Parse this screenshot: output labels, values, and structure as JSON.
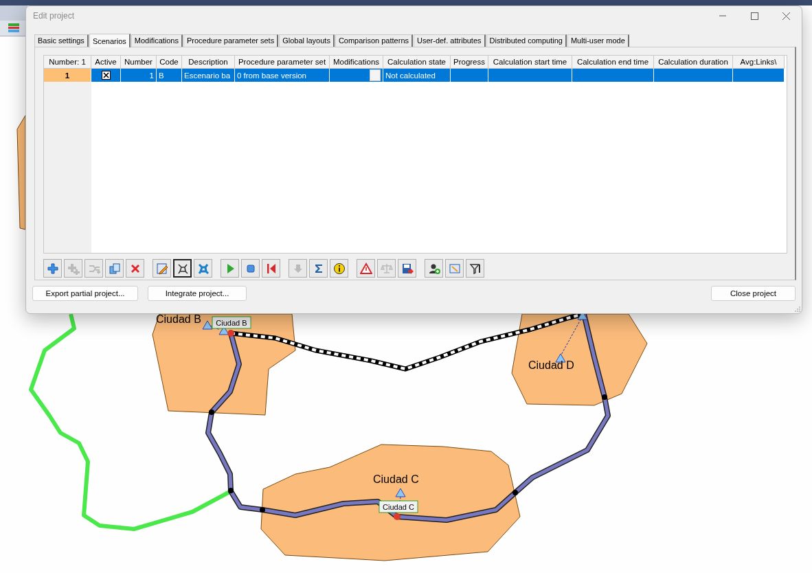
{
  "map": {
    "cities": [
      {
        "name": "Ciudad B",
        "tag": "Ciudad B"
      },
      {
        "name": "Ciudad D"
      },
      {
        "name": "Ciudad C",
        "tag": "Ciudad C"
      }
    ]
  },
  "window": {
    "title": "Edit project"
  },
  "tabs": [
    {
      "label": "Basic settings",
      "selected": false
    },
    {
      "label": "Scenarios",
      "selected": true
    },
    {
      "label": "Modifications",
      "selected": false
    },
    {
      "label": "Procedure parameter sets",
      "selected": false
    },
    {
      "label": "Global layouts",
      "selected": false
    },
    {
      "label": "Comparison patterns",
      "selected": false
    },
    {
      "label": "User-def. attributes",
      "selected": false
    },
    {
      "label": "Distributed computing",
      "selected": false
    },
    {
      "label": "Multi-user mode",
      "selected": false
    }
  ],
  "table": {
    "columns": [
      "Number: 1",
      "Active",
      "Number",
      "Code",
      "Description",
      "Procedure parameter set",
      "Modifications",
      "Calculation state",
      "Progress",
      "Calculation start time",
      "Calculation end time",
      "Calculation duration",
      "Avg:Links\\"
    ],
    "rows": [
      {
        "selected": true,
        "key": "1",
        "active": true,
        "number": "1",
        "code": "B",
        "description": "Escenario ba",
        "procedure_parameter_set": "0 from base version",
        "calculation_state": "Not calculated"
      }
    ]
  },
  "toolbar": [
    {
      "kind": "add",
      "disabled": false,
      "pressed": false
    },
    {
      "kind": "add-more",
      "disabled": true,
      "pressed": false
    },
    {
      "kind": "merge",
      "disabled": true,
      "pressed": false
    },
    {
      "kind": "copy",
      "disabled": false,
      "pressed": false
    },
    {
      "kind": "delete",
      "disabled": false,
      "pressed": false
    },
    {
      "kind": "edit",
      "disabled": false,
      "pressed": false
    },
    {
      "kind": "network",
      "disabled": false,
      "pressed": true
    },
    {
      "kind": "network-bold",
      "disabled": false,
      "pressed": false
    },
    {
      "kind": "play",
      "disabled": false,
      "pressed": false
    },
    {
      "kind": "stop",
      "disabled": false,
      "pressed": false
    },
    {
      "kind": "rewind",
      "disabled": false,
      "pressed": false
    },
    {
      "kind": "down",
      "disabled": true,
      "pressed": false
    },
    {
      "kind": "sum",
      "disabled": false,
      "pressed": false
    },
    {
      "kind": "info",
      "disabled": false,
      "pressed": false
    },
    {
      "kind": "warning",
      "disabled": false,
      "pressed": false
    },
    {
      "kind": "scale",
      "disabled": true,
      "pressed": false
    },
    {
      "kind": "save",
      "disabled": false,
      "pressed": false
    },
    {
      "kind": "user",
      "disabled": false,
      "pressed": false
    },
    {
      "kind": "window",
      "disabled": false,
      "pressed": false
    },
    {
      "kind": "filter",
      "disabled": false,
      "pressed": false
    }
  ],
  "buttons": {
    "left": [
      "Export partial project...",
      "Integrate project..."
    ],
    "right": [
      "Close project"
    ]
  }
}
